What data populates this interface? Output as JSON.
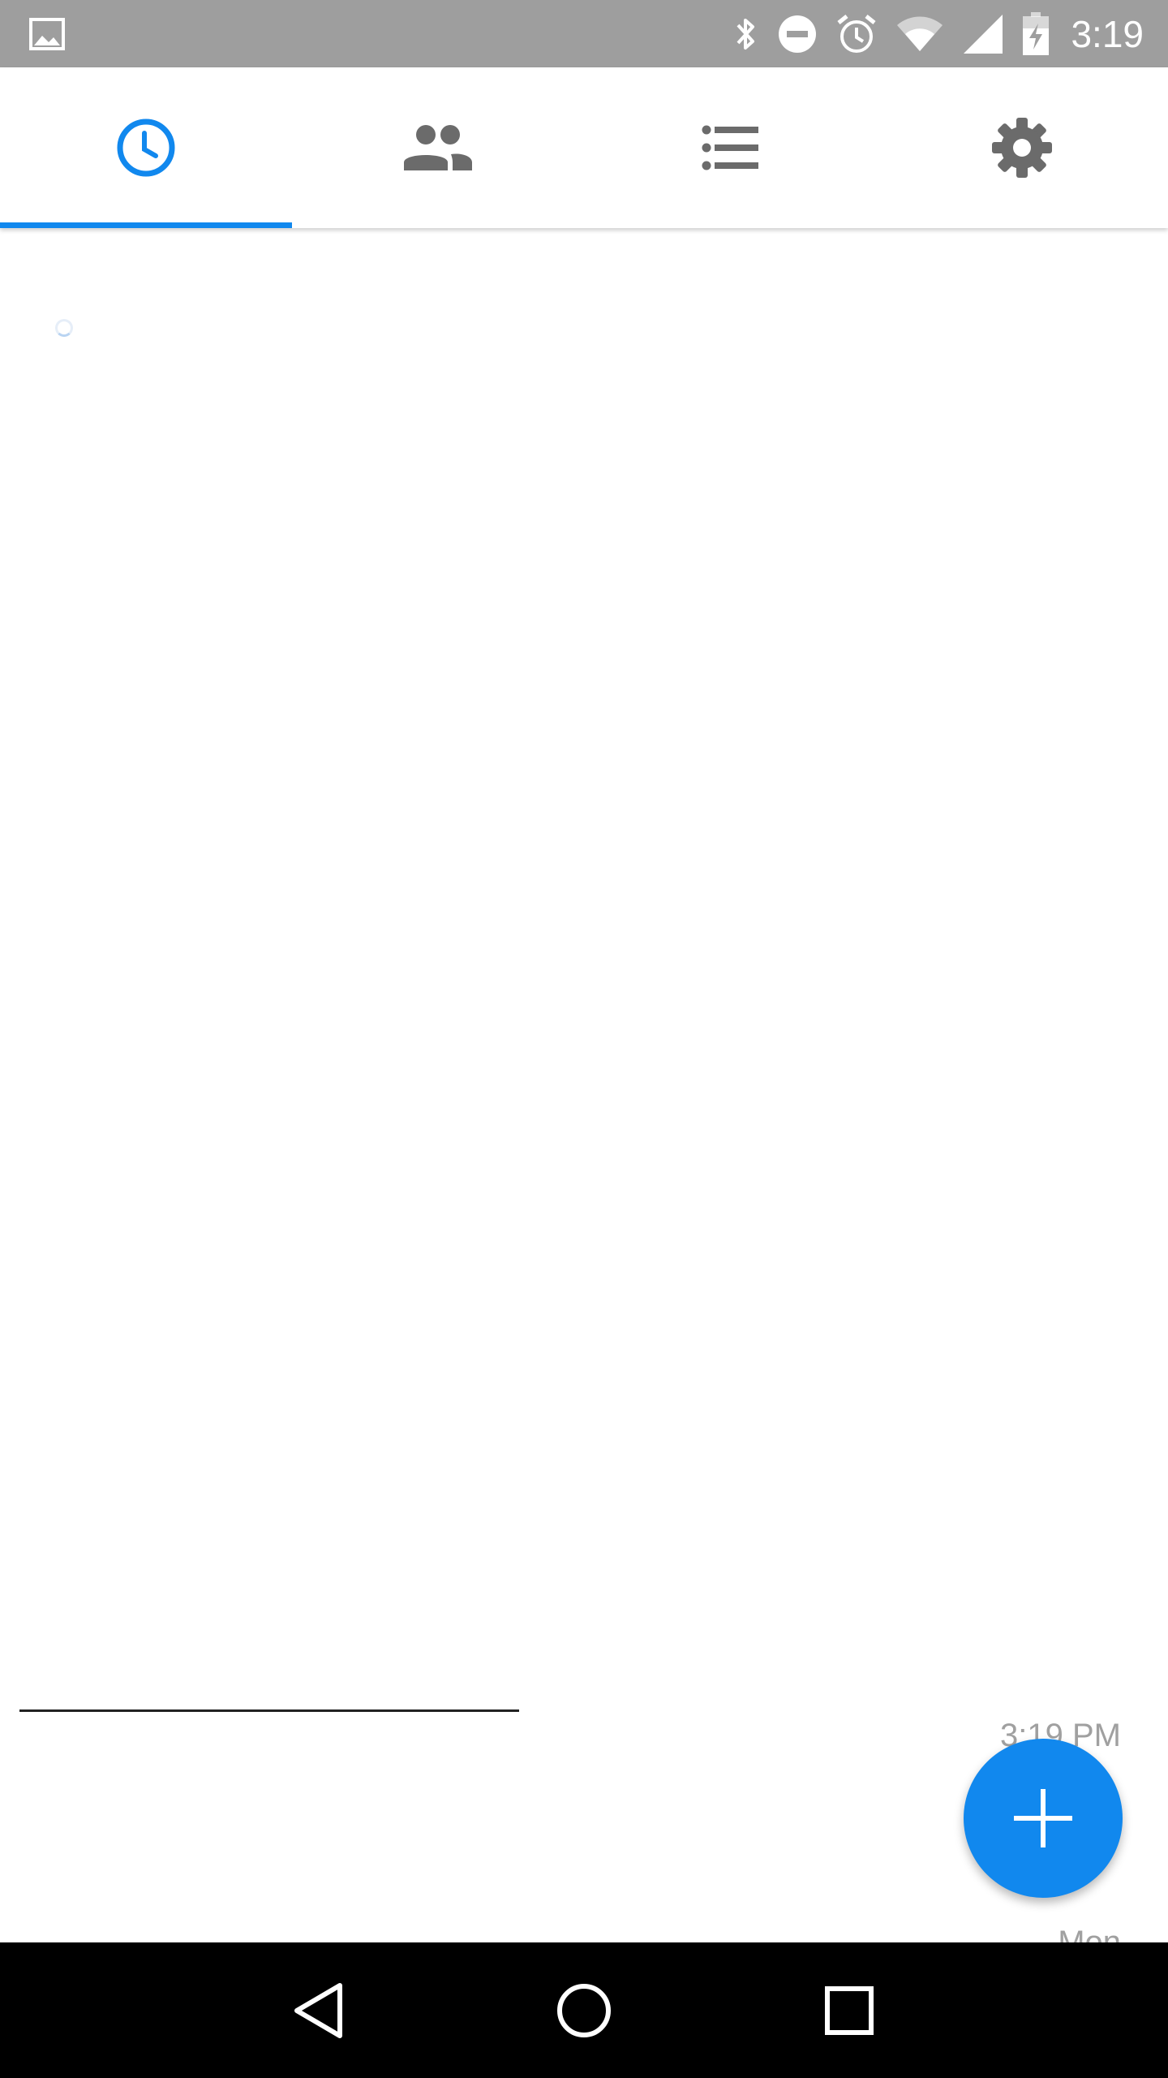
{
  "status_bar": {
    "time": "3:19",
    "icons": [
      "image-icon",
      "bluetooth-icon",
      "do-not-disturb-icon",
      "alarm-icon",
      "wifi-icon",
      "signal-icon",
      "battery-charging-icon"
    ]
  },
  "tabs": [
    {
      "id": "recent",
      "icon": "clock-icon",
      "active": true
    },
    {
      "id": "contacts",
      "icon": "people-icon",
      "active": false
    },
    {
      "id": "list",
      "icon": "list-icon",
      "active": false
    },
    {
      "id": "settings",
      "icon": "gear-icon",
      "active": false
    }
  ],
  "content": {
    "partial_time": "3:19 PM",
    "partial_day": "Mon"
  },
  "fab": {
    "icon": "plus-icon"
  },
  "nav_bar": {
    "buttons": [
      "back-icon",
      "home-icon",
      "recents-icon"
    ]
  },
  "colors": {
    "accent": "#1188ee",
    "status_bar": "#9e9e9e",
    "tab_icon_inactive": "#6b6b6b"
  }
}
